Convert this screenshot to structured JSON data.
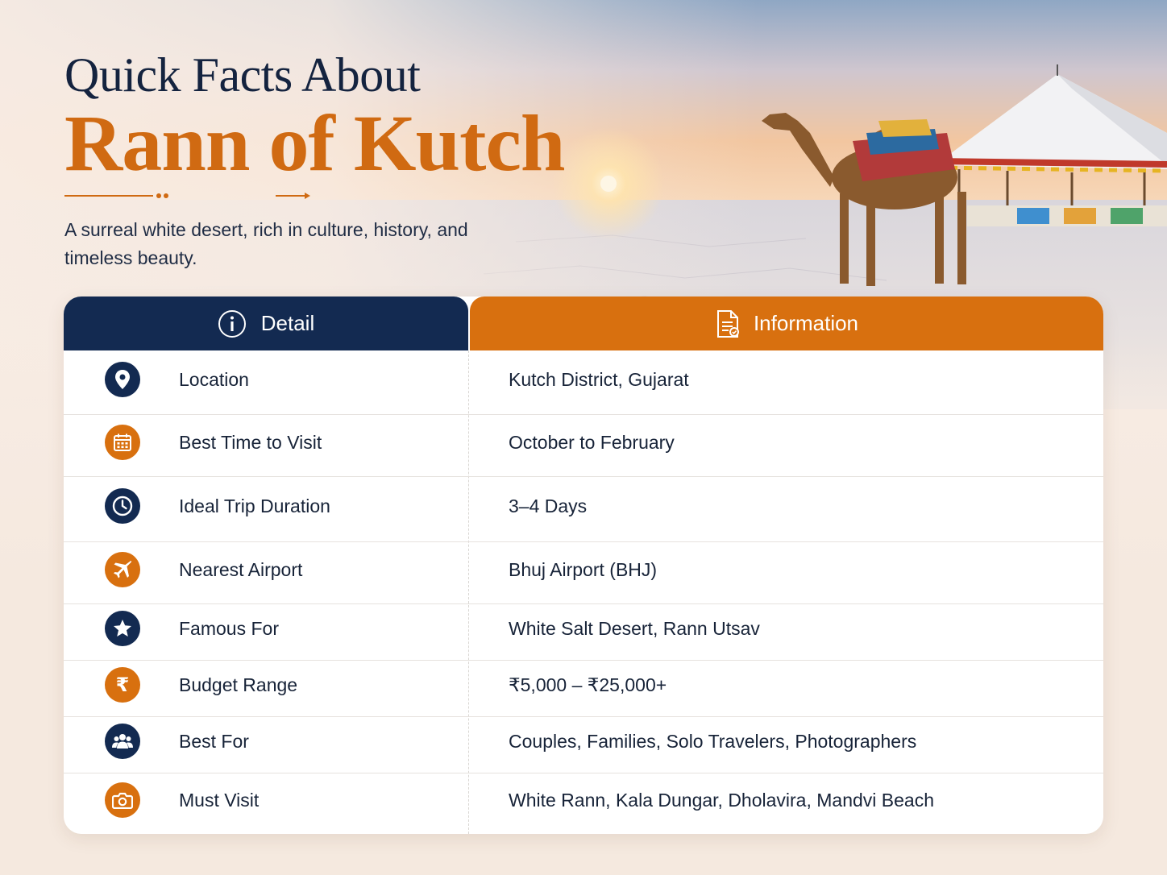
{
  "header": {
    "kicker": "Quick Facts About",
    "title": "Rann of Kutch",
    "subtitle": "A surreal white desert, rich in culture, history, and timeless beauty."
  },
  "table": {
    "col_detail": "Detail",
    "col_information": "Information",
    "rows": [
      {
        "label": "Location",
        "value": "Kutch District, Gujarat",
        "icon": "location-pin-icon",
        "color": "navy"
      },
      {
        "label": "Best Time to Visit",
        "value": "October to February",
        "icon": "calendar-icon",
        "color": "orange"
      },
      {
        "label": "Ideal Trip Duration",
        "value": "3–4 Days",
        "icon": "clock-icon",
        "color": "navy"
      },
      {
        "label": "Nearest Airport",
        "value": "Bhuj Airport (BHJ)",
        "icon": "airplane-icon",
        "color": "orange"
      },
      {
        "label": "Famous For",
        "value": "White Salt Desert, Rann Utsav",
        "icon": "star-icon",
        "color": "navy"
      },
      {
        "label": "Budget Range",
        "value": "₹5,000 – ₹25,000+",
        "icon": "rupee-icon",
        "color": "orange"
      },
      {
        "label": "Best For",
        "value": "Couples, Families, Solo Travelers, Photographers",
        "icon": "group-icon",
        "color": "navy"
      },
      {
        "label": "Must Visit",
        "value": "White Rann, Kala Dungar, Dholavira, Mandvi Beach",
        "icon": "camera-icon",
        "color": "orange"
      }
    ]
  },
  "colors": {
    "navy": "#132a51",
    "orange": "#d8700f",
    "title_orange": "#d06a12"
  }
}
